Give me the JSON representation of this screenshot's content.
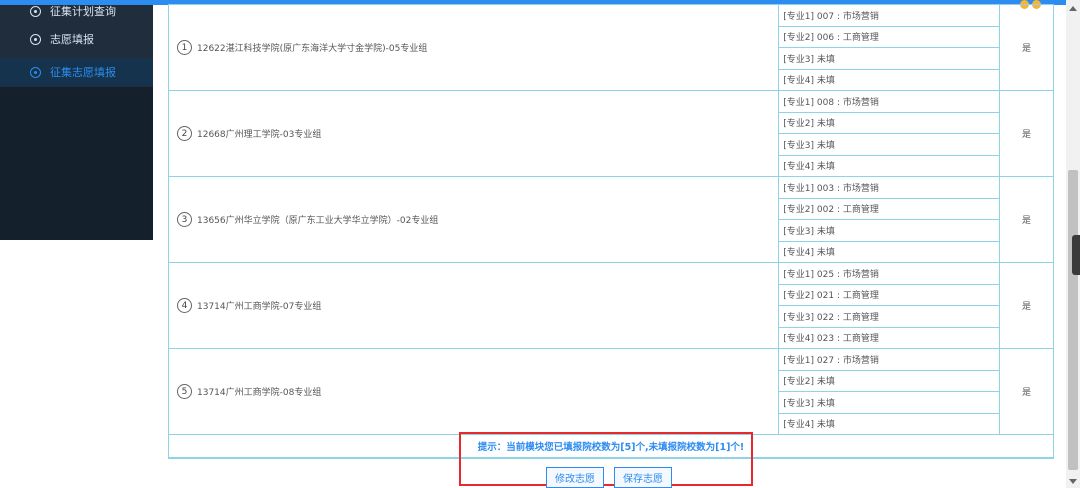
{
  "colors": {
    "accent": "#2d8cf0",
    "sidebar_bg": "#1f2d3d",
    "table_border": "#8fd3e8",
    "highlight": "#e8282b"
  },
  "sidebar": {
    "items": [
      {
        "label": "征集计划查询",
        "icon": "circle-dot-icon"
      },
      {
        "label": "志愿填报",
        "icon": "circle-dot-icon"
      },
      {
        "label": "征集志愿填报",
        "icon": "circle-dot-icon",
        "active": true
      }
    ]
  },
  "choices": [
    {
      "num": "1",
      "school": "12622湛江科技学院(原广东海洋大学寸金学院)-05专业组",
      "majors": [
        "[专业1] 007 : 市场营销",
        "[专业2] 006 : 工商管理",
        "[专业3] 未填",
        "[专业4] 未填"
      ],
      "obey": "是"
    },
    {
      "num": "2",
      "school": "12668广州理工学院-03专业组",
      "majors": [
        "[专业1] 008 : 市场营销",
        "[专业2] 未填",
        "[专业3] 未填",
        "[专业4] 未填"
      ],
      "obey": "是"
    },
    {
      "num": "3",
      "school": "13656广州华立学院（原广东工业大学华立学院）-02专业组",
      "majors": [
        "[专业1] 003 : 市场营销",
        "[专业2] 002 : 工商管理",
        "[专业3] 未填",
        "[专业4] 未填"
      ],
      "obey": "是"
    },
    {
      "num": "4",
      "school": "13714广州工商学院-07专业组",
      "majors": [
        "[专业1] 025 : 市场营销",
        "[专业2] 021 : 工商管理",
        "[专业3] 022 : 工商管理",
        "[专业4] 023 : 工商管理"
      ],
      "obey": "是"
    },
    {
      "num": "5",
      "school": "13714广州工商学院-08专业组",
      "majors": [
        "[专业1] 027 : 市场营销",
        "[专业2] 未填",
        "[专业3] 未填",
        "[专业4] 未填"
      ],
      "obey": "是"
    }
  ],
  "hint": "提示：当前模块您已填报院校数为[5]个,未填报院校数为[1]个!",
  "buttons": {
    "modify": "修改志愿",
    "save": "保存志愿"
  }
}
